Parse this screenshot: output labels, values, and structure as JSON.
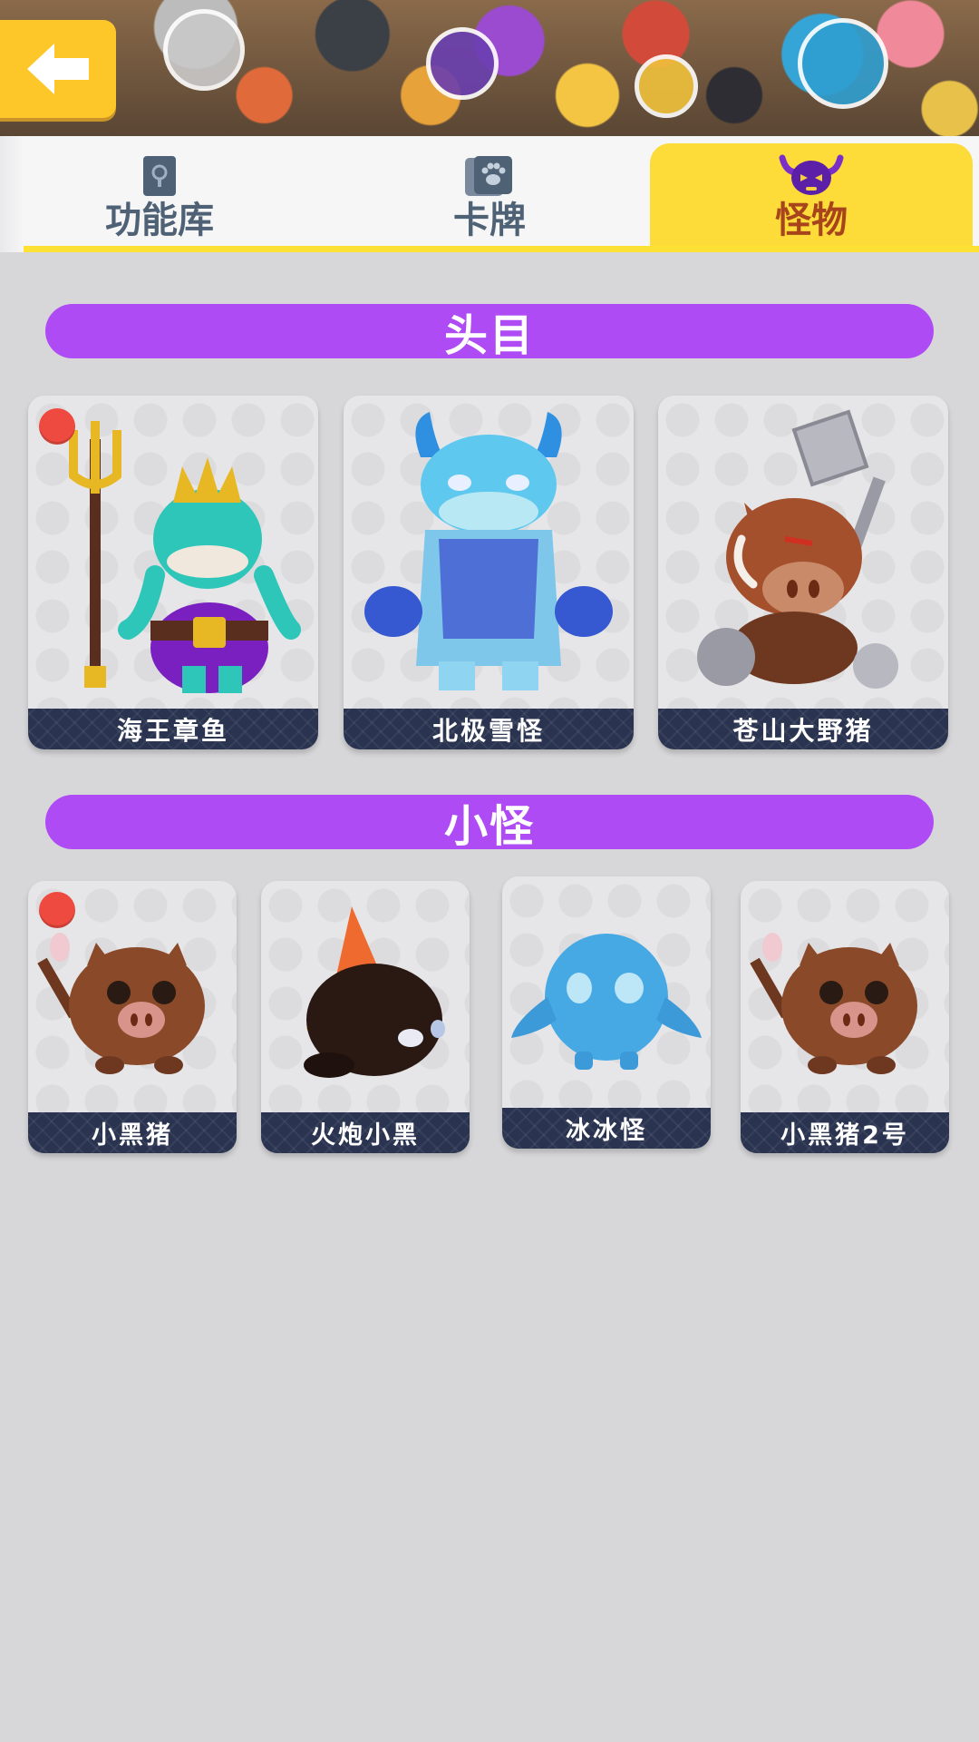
{
  "header": {
    "back_icon": "arrow-left-icon",
    "accent": "#fdc629"
  },
  "tabs": [
    {
      "label": "功能库",
      "icon": "book-icon",
      "active": false
    },
    {
      "label": "卡牌",
      "icon": "paw-card-icon",
      "active": false
    },
    {
      "label": "怪物",
      "icon": "demon-skull-icon",
      "active": true
    }
  ],
  "sections": {
    "bosses": {
      "title": "头目",
      "items": [
        {
          "name": "海王章鱼",
          "new": true
        },
        {
          "name": "北极雪怪",
          "new": false
        },
        {
          "name": "苍山大野猪",
          "new": false
        }
      ]
    },
    "minions": {
      "title": "小怪",
      "items": [
        {
          "name": "小黑猪",
          "new": true
        },
        {
          "name": "火炮小黑",
          "new": false
        },
        {
          "name": "冰冰怪",
          "new": false
        },
        {
          "name": "小黑猪2号",
          "new": false
        }
      ]
    }
  },
  "colors": {
    "section_header": "#ae4bf4",
    "active_tab": "#fddb38",
    "name_bar": "#2a3450",
    "badge": "#ee4a3f"
  }
}
